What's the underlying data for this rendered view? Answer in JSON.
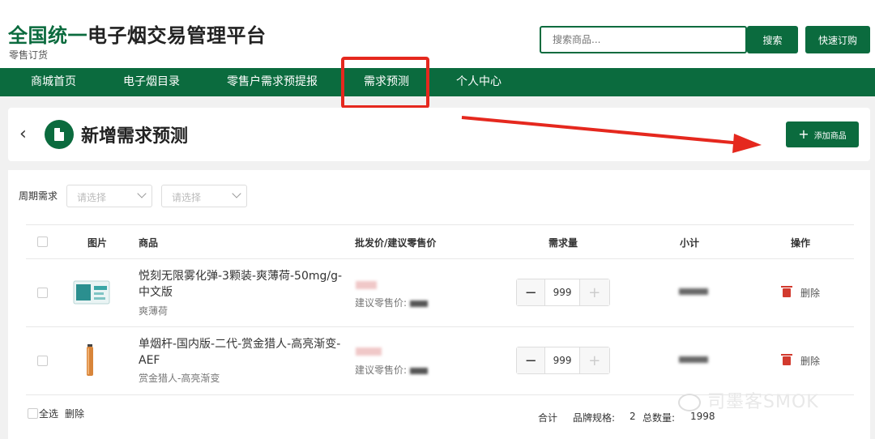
{
  "header": {
    "title_green": "全国统一",
    "title_rest": "电子烟交易管理平台",
    "subtitle": "零售订货",
    "search_placeholder": "搜索商品...",
    "search_button": "搜索",
    "quick_order_button": "快速订购"
  },
  "nav": {
    "items": [
      "商城首页",
      "电子烟目录",
      "零售户需求预提报",
      "需求预测",
      "个人中心"
    ],
    "highlighted": "需求预测"
  },
  "page": {
    "title": "新增需求预测",
    "add_button": "添加商品"
  },
  "filter": {
    "label": "周期需求",
    "select1_placeholder": "请选择",
    "select2_placeholder": "请选择"
  },
  "table": {
    "headers": [
      "图片",
      "商品",
      "批发价/建议零售价",
      "需求量",
      "小计",
      "操作"
    ],
    "rows": [
      {
        "name": "悦刻无限雾化弹-3颗装-爽薄荷-50mg/g-中文版",
        "spec": "爽薄荷",
        "suggest_label": "建议零售价:",
        "quantity": "999",
        "delete_label": "删除"
      },
      {
        "name": "单烟杆-国内版-二代-赏金猎人-高亮渐变-AEF",
        "spec": "赏金猎人-高亮渐变",
        "suggest_label": "建议零售价:",
        "quantity": "999",
        "delete_label": "删除"
      }
    ]
  },
  "footer": {
    "select_all": "全选",
    "delete": "删除",
    "total_label": "合计",
    "brand_spec_label": "品牌规格:",
    "brand_spec_value": "2",
    "total_qty_label": "总数量:",
    "total_qty_value": "1998"
  },
  "watermark": "司墨客SMOK",
  "colors": {
    "brand": "#0b6b3e",
    "highlight_red": "#e5281e",
    "delete_icon": "#d23a2e"
  }
}
